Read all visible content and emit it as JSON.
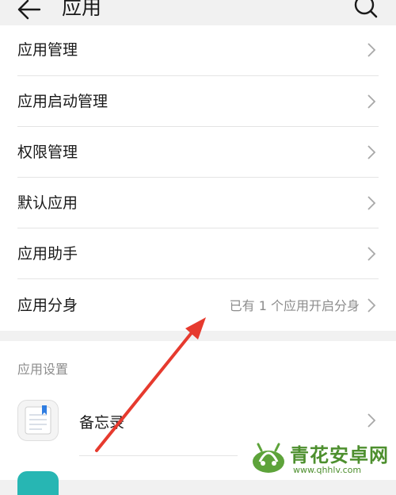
{
  "header": {
    "title": "应用"
  },
  "rows": [
    {
      "label": "应用管理",
      "value": ""
    },
    {
      "label": "应用启动管理",
      "value": ""
    },
    {
      "label": "权限管理",
      "value": ""
    },
    {
      "label": "默认应用",
      "value": ""
    },
    {
      "label": "应用助手",
      "value": ""
    },
    {
      "label": "应用分身",
      "value": "已有 1 个应用开启分身"
    }
  ],
  "section": {
    "title": "应用设置",
    "apps": [
      {
        "name": "备忘录"
      }
    ]
  },
  "watermark": {
    "text": "青花安卓网",
    "url": "www.qhhlv.com"
  },
  "colors": {
    "annotation_arrow": "#e63a2e",
    "watermark": "#4d8f2e",
    "app_icon_teal": "#27b6b3"
  },
  "icons": [
    "back-arrow-icon",
    "search-icon",
    "chevron-right-icon",
    "memo-app-icon",
    "watermark-logo-icon"
  ]
}
